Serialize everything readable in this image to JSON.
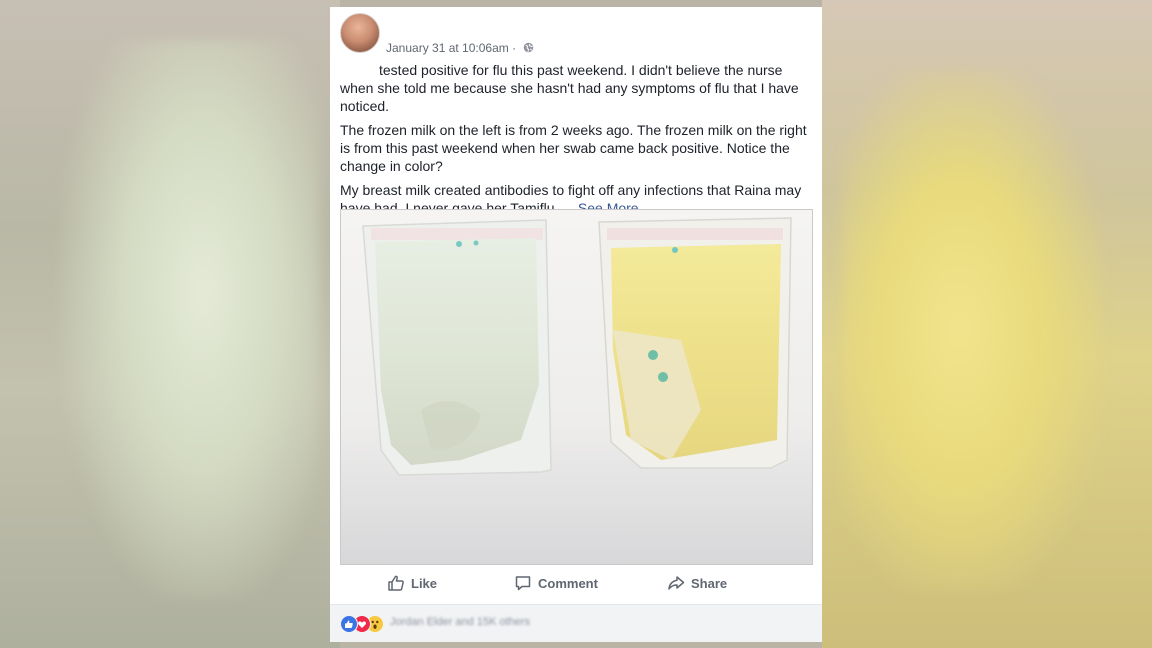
{
  "post": {
    "timestamp": "January 31 at 10:06am · ",
    "paragraphs": [
      "tested positive for flu this past weekend. I didn't believe the nurse when she told me because she hasn't had any symptoms of flu that I have noticed.",
      "The frozen milk on the left is from 2 weeks ago. The frozen milk on the right is from this past weekend when her swab came back positive. Notice the change in color?",
      "My breast milk created antibodies to fight off any infections that Raina may have had. I never gave her Tamiflu. ..."
    ],
    "see_more": "See More",
    "privacy_icon": "globe-icon"
  },
  "actions": {
    "like": "Like",
    "comment": "Comment",
    "share": "Share"
  },
  "reactions": {
    "icons": [
      "like-reaction-icon",
      "love-reaction-icon",
      "wow-reaction-icon"
    ],
    "names": "Jordan Elder and 15K others"
  },
  "colors": {
    "link": "#385898",
    "text": "#1d2129",
    "meta": "#616770",
    "like_blue": "#3b75e5",
    "love_red": "#f0284a",
    "wow_yellow": "#f7c940"
  }
}
